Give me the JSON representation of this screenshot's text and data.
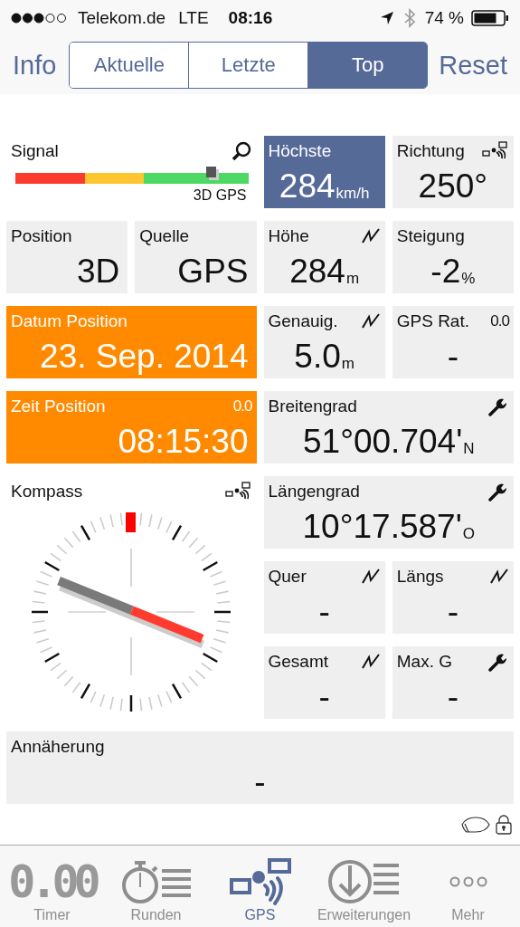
{
  "status_bar": {
    "carrier": "Telekom.de",
    "network": "LTE",
    "time": "08:16",
    "battery": "74 %"
  },
  "nav": {
    "left": "Info",
    "right": "Reset",
    "segments": [
      {
        "label": "Aktuelle",
        "selected": false
      },
      {
        "label": "Letzte",
        "selected": false
      },
      {
        "label": "Top",
        "selected": true
      }
    ]
  },
  "tiles": [
    {
      "kind": "signal",
      "title": "Signal",
      "level": 0.84,
      "reading": "3D GPS"
    },
    {
      "kind": "value",
      "title": "Höchste",
      "value": "284",
      "unit": "km/h",
      "color": "#566a98"
    },
    {
      "kind": "value",
      "title": "Richtung",
      "value": "250°"
    },
    {
      "kind": "value",
      "title": "Position",
      "value": "3D"
    },
    {
      "kind": "value",
      "title": "Quelle",
      "value": "GPS"
    },
    {
      "kind": "value",
      "title": "Höhe",
      "value": "284",
      "unit": "m"
    },
    {
      "kind": "value",
      "title": "Steigung",
      "value": "-2",
      "unit": "%"
    },
    {
      "kind": "value",
      "title": "Datum Position",
      "value": "23. Sep. 2014",
      "color": "#ff8a00"
    },
    {
      "kind": "value",
      "title": "Genauig.",
      "value": "5.0",
      "unit": "m"
    },
    {
      "kind": "value",
      "title": "GPS Rat.",
      "corner": "0.0",
      "value": "-"
    },
    {
      "kind": "value",
      "title": "Zeit Position",
      "corner": "0.0",
      "value": "08:15:30",
      "color": "#ff8a00"
    },
    {
      "kind": "value",
      "title": "Breitengrad",
      "value": "51°00.704'",
      "unit": "N"
    },
    {
      "kind": "compass",
      "title": "Kompass"
    },
    {
      "kind": "value",
      "title": "Längengrad",
      "value": "10°17.587'",
      "unit": "O"
    },
    {
      "kind": "value",
      "title": "Quer",
      "value": "-"
    },
    {
      "kind": "value",
      "title": "Längs",
      "value": "-"
    },
    {
      "kind": "value",
      "title": "Gesamt",
      "value": "-"
    },
    {
      "kind": "value",
      "title": "Max. G",
      "value": "-"
    },
    {
      "kind": "value",
      "title": "Annäherung",
      "value": "-"
    }
  ],
  "tabs": [
    {
      "kind": "timer",
      "label": "Timer",
      "icon_text": "0.00",
      "selected": false
    },
    {
      "kind": "laps",
      "label": "Runden",
      "selected": false
    },
    {
      "kind": "gps",
      "label": "GPS",
      "selected": true
    },
    {
      "kind": "extensions",
      "label": "Erweiterungen",
      "selected": false
    },
    {
      "kind": "more",
      "label": "Mehr",
      "selected": false
    }
  ]
}
